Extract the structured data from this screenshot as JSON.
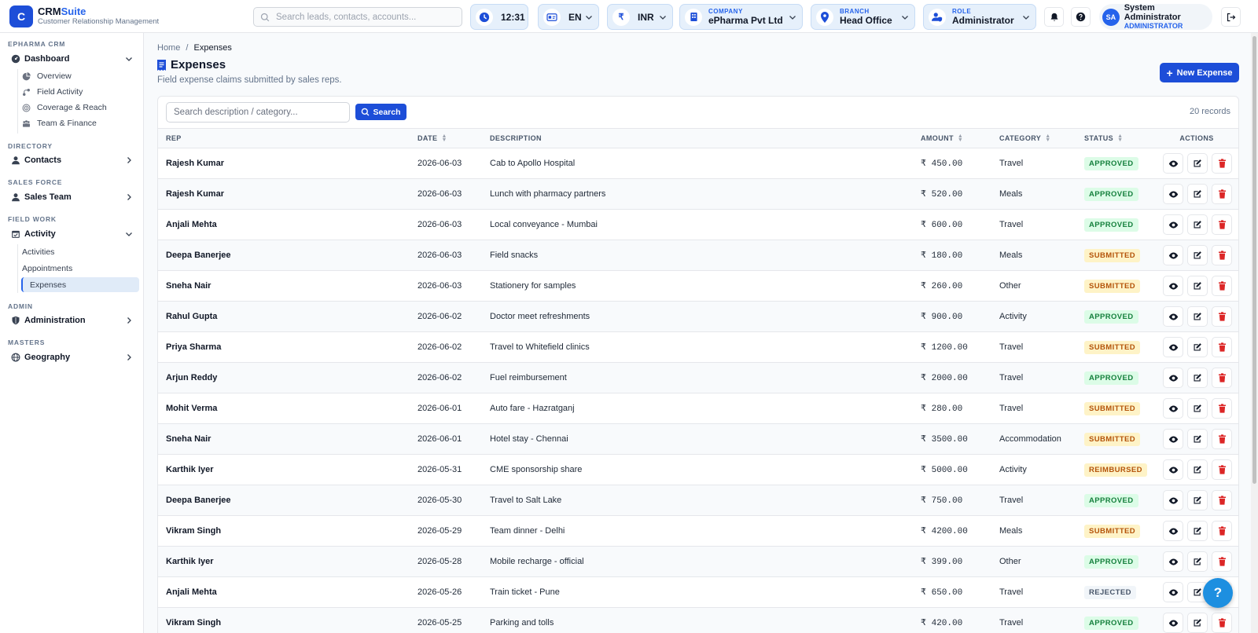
{
  "app": {
    "logo_letter": "C",
    "name_a": "CRM",
    "name_b": "Suite",
    "subtitle": "Customer Relationship Management"
  },
  "header": {
    "search_placeholder": "Search leads, contacts, accounts...",
    "time": "12:31",
    "language": "EN",
    "currency_symbol": "₹",
    "currency": "INR",
    "company_label": "COMPANY",
    "company": "ePharma Pvt Ltd",
    "branch_label": "BRANCH",
    "branch": "Head Office",
    "role_label": "ROLE",
    "role": "Administrator",
    "user_initials": "SA",
    "user_name": "System Administrator",
    "user_role": "ADMINISTRATOR"
  },
  "sidebar": {
    "sec_epharma": "EPHARMA CRM",
    "dashboard": "Dashboard",
    "overview": "Overview",
    "field_activity": "Field Activity",
    "coverage": "Coverage & Reach",
    "team_finance": "Team & Finance",
    "sec_directory": "DIRECTORY",
    "contacts": "Contacts",
    "sec_sales": "SALES FORCE",
    "sales_team": "Sales Team",
    "sec_field": "FIELD WORK",
    "activity": "Activity",
    "activities": "Activities",
    "appointments": "Appointments",
    "expenses": "Expenses",
    "sec_admin": "ADMIN",
    "administration": "Administration",
    "sec_masters": "MASTERS",
    "geography": "Geography"
  },
  "page": {
    "crumb_home": "Home",
    "crumb_sep": "/",
    "crumb_current": "Expenses",
    "title": "Expenses",
    "subtitle": "Field expense claims submitted by sales reps.",
    "new_button": "New Expense",
    "search_placeholder": "Search description / category...",
    "search_button": "Search",
    "record_count": "20 records"
  },
  "table": {
    "columns": [
      "REP",
      "DATE",
      "DESCRIPTION",
      "AMOUNT",
      "CATEGORY",
      "STATUS",
      "ACTIONS"
    ],
    "rows": [
      {
        "rep": "Rajesh Kumar",
        "date": "2026-06-03",
        "desc": "Cab to Apollo Hospital",
        "amount": "₹ 450.00",
        "category": "Travel",
        "status": "APPROVED"
      },
      {
        "rep": "Rajesh Kumar",
        "date": "2026-06-03",
        "desc": "Lunch with pharmacy partners",
        "amount": "₹ 520.00",
        "category": "Meals",
        "status": "APPROVED"
      },
      {
        "rep": "Anjali Mehta",
        "date": "2026-06-03",
        "desc": "Local conveyance - Mumbai",
        "amount": "₹ 600.00",
        "category": "Travel",
        "status": "APPROVED"
      },
      {
        "rep": "Deepa Banerjee",
        "date": "2026-06-03",
        "desc": "Field snacks",
        "amount": "₹ 180.00",
        "category": "Meals",
        "status": "SUBMITTED"
      },
      {
        "rep": "Sneha Nair",
        "date": "2026-06-03",
        "desc": "Stationery for samples",
        "amount": "₹ 260.00",
        "category": "Other",
        "status": "SUBMITTED"
      },
      {
        "rep": "Rahul Gupta",
        "date": "2026-06-02",
        "desc": "Doctor meet refreshments",
        "amount": "₹ 900.00",
        "category": "Activity",
        "status": "APPROVED"
      },
      {
        "rep": "Priya Sharma",
        "date": "2026-06-02",
        "desc": "Travel to Whitefield clinics",
        "amount": "₹ 1200.00",
        "category": "Travel",
        "status": "SUBMITTED"
      },
      {
        "rep": "Arjun Reddy",
        "date": "2026-06-02",
        "desc": "Fuel reimbursement",
        "amount": "₹ 2000.00",
        "category": "Travel",
        "status": "APPROVED"
      },
      {
        "rep": "Mohit Verma",
        "date": "2026-06-01",
        "desc": "Auto fare - Hazratganj",
        "amount": "₹ 280.00",
        "category": "Travel",
        "status": "SUBMITTED"
      },
      {
        "rep": "Sneha Nair",
        "date": "2026-06-01",
        "desc": "Hotel stay - Chennai",
        "amount": "₹ 3500.00",
        "category": "Accommodation",
        "status": "SUBMITTED"
      },
      {
        "rep": "Karthik Iyer",
        "date": "2026-05-31",
        "desc": "CME sponsorship share",
        "amount": "₹ 5000.00",
        "category": "Activity",
        "status": "REIMBURSED"
      },
      {
        "rep": "Deepa Banerjee",
        "date": "2026-05-30",
        "desc": "Travel to Salt Lake",
        "amount": "₹ 750.00",
        "category": "Travel",
        "status": "APPROVED"
      },
      {
        "rep": "Vikram Singh",
        "date": "2026-05-29",
        "desc": "Team dinner - Delhi",
        "amount": "₹ 4200.00",
        "category": "Meals",
        "status": "SUBMITTED"
      },
      {
        "rep": "Karthik Iyer",
        "date": "2026-05-28",
        "desc": "Mobile recharge - official",
        "amount": "₹ 399.00",
        "category": "Other",
        "status": "APPROVED"
      },
      {
        "rep": "Anjali Mehta",
        "date": "2026-05-26",
        "desc": "Train ticket - Pune",
        "amount": "₹ 650.00",
        "category": "Travel",
        "status": "REJECTED"
      },
      {
        "rep": "Vikram Singh",
        "date": "2026-05-25",
        "desc": "Parking and tolls",
        "amount": "₹ 420.00",
        "category": "Travel",
        "status": "APPROVED"
      }
    ]
  },
  "help": {
    "label": "?"
  },
  "colors": {
    "primary": "#1d4ed8",
    "approved": "#15803d",
    "submitted": "#b45309",
    "delete": "#dc2626"
  }
}
